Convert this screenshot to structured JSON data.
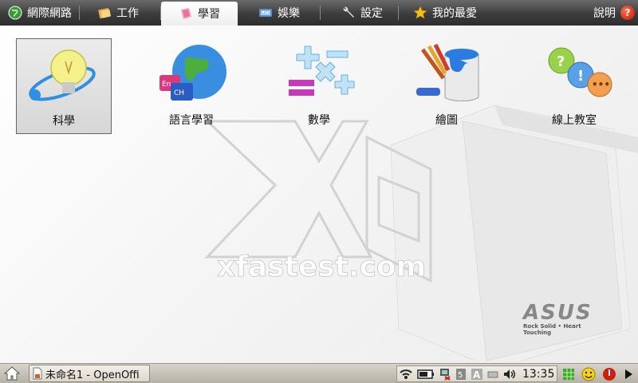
{
  "tabs": [
    {
      "label": "網際網路",
      "icon": "globe-icon"
    },
    {
      "label": "工作",
      "icon": "folder-icon"
    },
    {
      "label": "學習",
      "icon": "learning-icon",
      "active": true
    },
    {
      "label": "娛樂",
      "icon": "entertainment-icon"
    },
    {
      "label": "設定",
      "icon": "wrench-icon"
    },
    {
      "label": "我的最愛",
      "icon": "star-icon"
    }
  ],
  "help": {
    "label": "說明",
    "icon": "help-icon"
  },
  "apps": [
    {
      "label": "科學",
      "icon": "lightbulb-icon",
      "selected": true
    },
    {
      "label": "語言學習",
      "icon": "globe-language-icon"
    },
    {
      "label": "數學",
      "icon": "math-symbols-icon"
    },
    {
      "label": "繪圖",
      "icon": "paint-bucket-icon"
    },
    {
      "label": "線上教室",
      "icon": "online-classroom-icon"
    }
  ],
  "watermark": {
    "text": "xfastest.com"
  },
  "brand": {
    "name": "ASUS",
    "tagline": "Rock Solid • Heart Touching"
  },
  "taskbar": {
    "task_label": "未命名1 - OpenOffi",
    "clock": "13:35",
    "tray_icons": [
      "wireless-icon",
      "battery-icon",
      "network-icon",
      "keyboard-icon",
      "font-icon",
      "drive-icon",
      "volume-icon"
    ],
    "right_icons": [
      "grid-icon",
      "smiley-icon",
      "power-icon",
      "arrow-right-icon"
    ]
  },
  "colors": {
    "tabbar": "#3c3c3c",
    "taskbar": "#c8c4ba",
    "accent_red": "#d21d0c"
  }
}
